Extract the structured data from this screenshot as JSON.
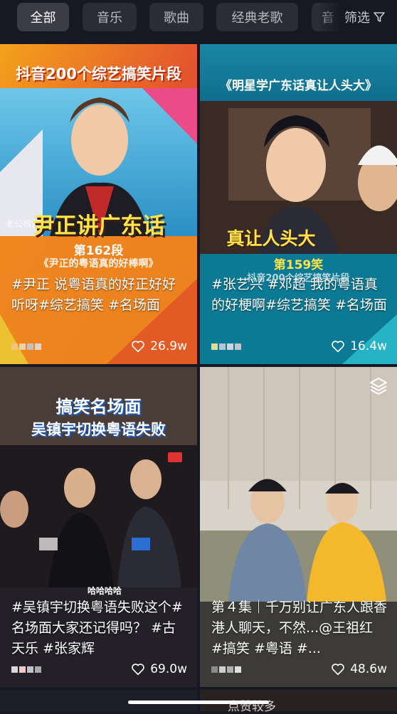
{
  "filters": {
    "chips": [
      "全部",
      "音乐",
      "歌曲",
      "经典老歌",
      "音"
    ],
    "filter_label": "筛选"
  },
  "videos": [
    {
      "banner": "抖音200个综艺搞笑片段",
      "subtitle": "尹正讲广东话",
      "episode": "第162段",
      "episode_sub": "《尹正的粤语真的好棒啊》",
      "watermark": "老公很爱",
      "caption": "#尹正 说粤语真的好正好好听呀#综艺搞笑 #名场面",
      "likes": "26.9w"
    },
    {
      "banner": "《明星学广东话真让人头大》",
      "subtitle": "真让人头大",
      "episode": "第159笑",
      "episode_sub": "抖音200个综艺搞笑片段",
      "caption": "#张艺兴 #邓超 我的粤语真的好梗啊#综艺搞笑 #名场面",
      "likes": "16.4w"
    },
    {
      "banner": "搞笑名场面",
      "banner2": "吴镇宇切换粤语失败",
      "subtitle": "哈哈哈哈",
      "caption": "#吴镇宇切换粤语失败这个#名场面大家还记得吗？ #古天乐 #张家辉",
      "likes": "69.0w"
    },
    {
      "caption": "第４集｜千万别让广东人跟香港人聊天，不然...@王祖红 #搞笑 #粤语 #...",
      "likes": "48.6w"
    }
  ],
  "bottom": {
    "peek_text": "点赞较多"
  },
  "colors": {
    "background": "#161823",
    "chip": "#2b2c35",
    "chip_active": "#3b3c46",
    "text": "#ffffff"
  },
  "icons": [
    "filter-funnel-icon",
    "heart-outline-icon",
    "stacked-layers-icon"
  ]
}
